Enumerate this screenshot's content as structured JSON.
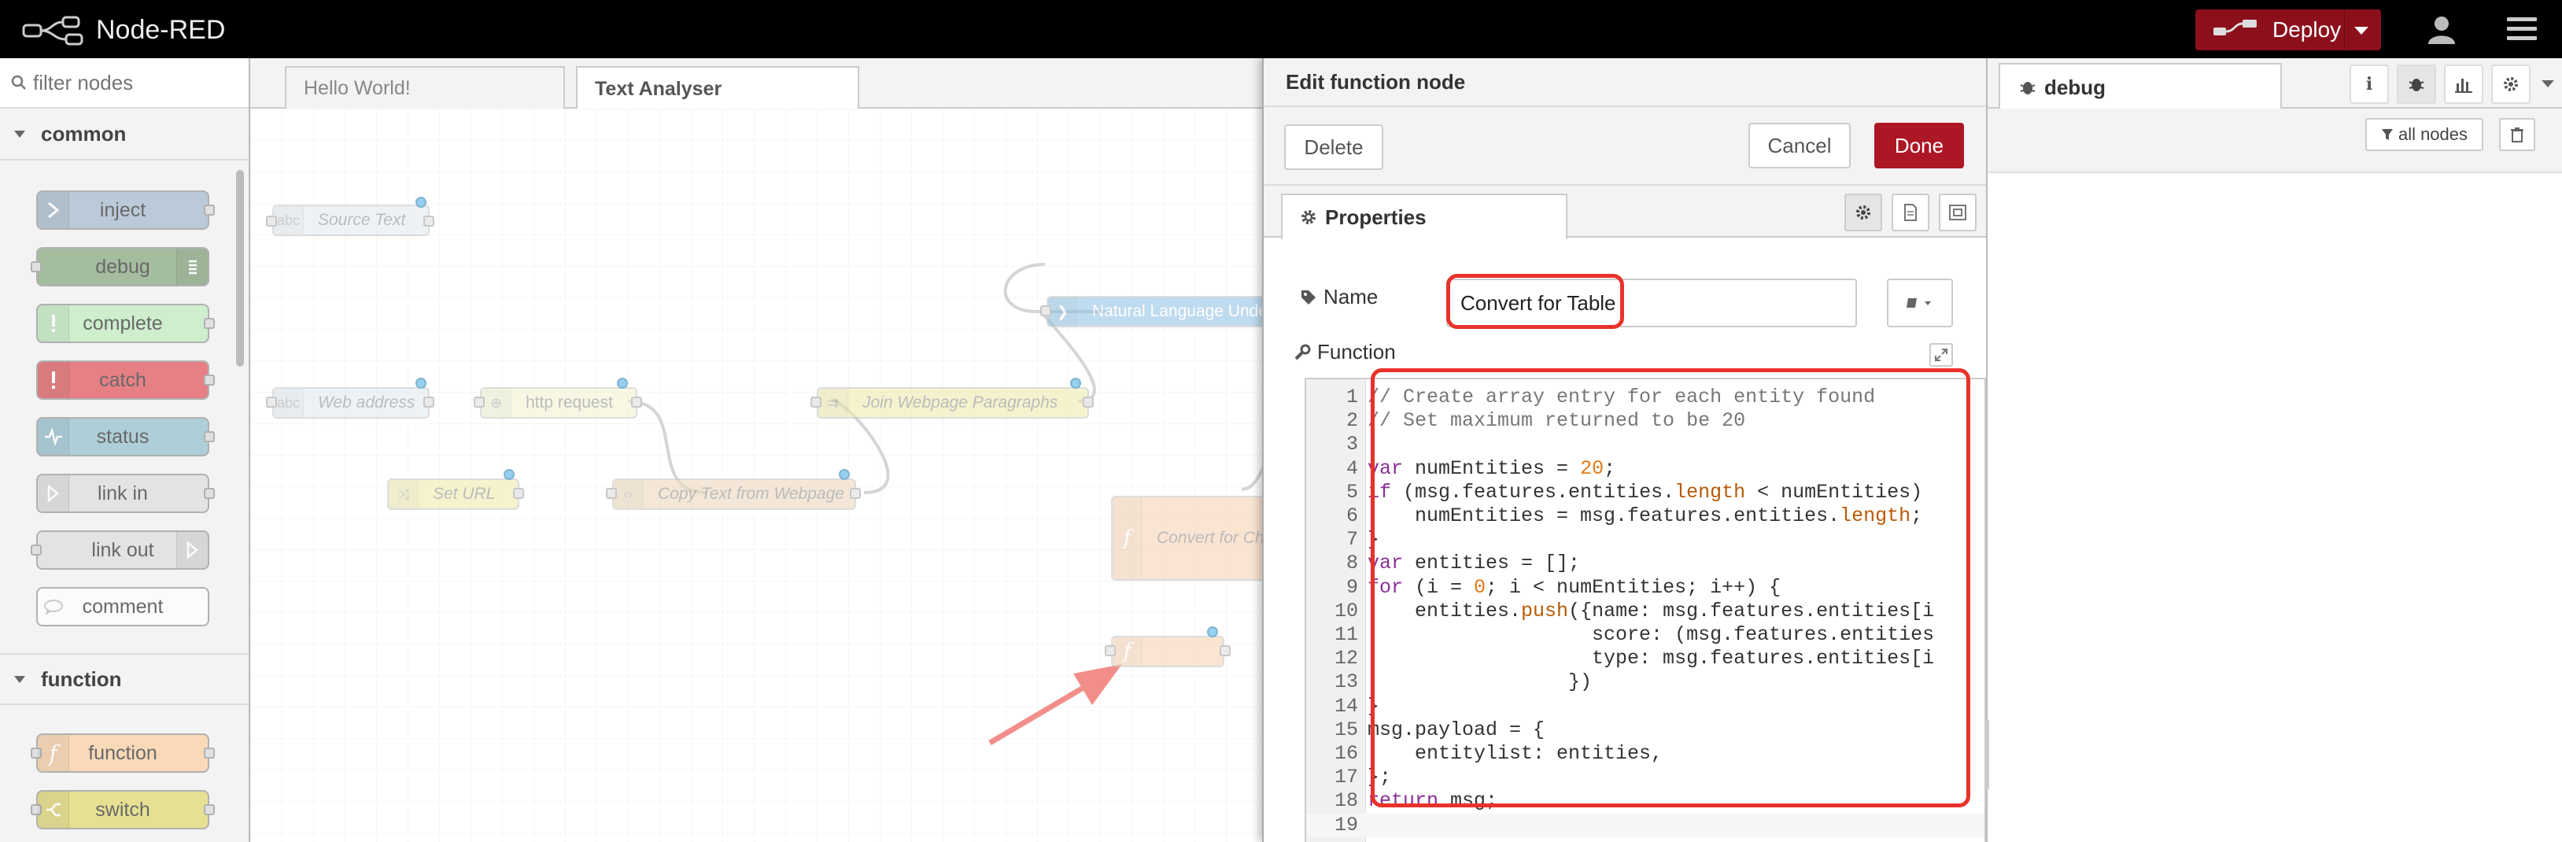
{
  "app": {
    "title": "Node-RED",
    "deploy_label": "Deploy"
  },
  "palette": {
    "search_placeholder": "filter nodes",
    "categories": [
      {
        "label": "common",
        "nodes": [
          "inject",
          "debug",
          "complete",
          "catch",
          "status",
          "link in",
          "link out",
          "comment"
        ]
      },
      {
        "label": "function",
        "nodes": [
          "function",
          "switch"
        ]
      }
    ]
  },
  "workspace": {
    "tabs": [
      "Hello World!",
      "Text Analyser"
    ],
    "active_tab": "Text Analyser",
    "flow_nodes": {
      "source_text": "Source Text",
      "web_address": "Web address",
      "http_request": "http request",
      "set_url": "Set URL",
      "copy_text": "Copy Text from Webpage",
      "join_paragraphs": "Join Webpage Paragraphs",
      "nlu": "Natural Language Under",
      "convert_chart": "Convert for Cha"
    }
  },
  "tray": {
    "title": "Edit function node",
    "delete_label": "Delete",
    "cancel_label": "Cancel",
    "done_label": "Done",
    "properties_tab": "Properties",
    "name_label": "Name",
    "name_value": "Convert for Table",
    "function_label": "Function",
    "code_lines": [
      "// Create array entry for each entity found",
      "// Set maximum returned to be 20",
      "",
      "var numEntities = 20;",
      "if (msg.features.entities.length < numEntities)",
      "    numEntities = msg.features.entities.length;",
      "}",
      "var entities = [];",
      "for (i = 0; i < numEntities; i++) {",
      "    entities.push({name: msg.features.entities[i",
      "                   score: (msg.features.entities",
      "                   type: msg.features.entities[i",
      "                 })",
      "}",
      "msg.payload = {",
      "    entitylist: entities,",
      "};",
      "return msg;",
      ""
    ]
  },
  "sidebar": {
    "active_tab": "debug",
    "filter_label": "all nodes"
  },
  "colors": {
    "header_bg": "#000000",
    "deploy_bg": "#8c101c",
    "done_bg": "#ad1625",
    "annotation": "#e8322a"
  }
}
